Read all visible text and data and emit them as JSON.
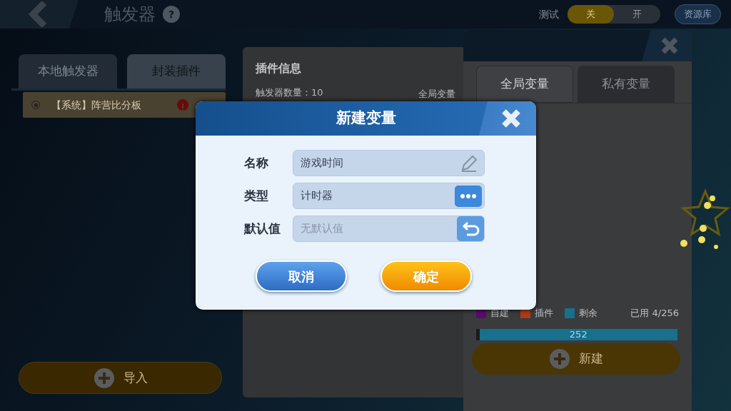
{
  "top_bar": {
    "title": "触发器",
    "help": "?",
    "test_label": "测试",
    "toggle": [
      {
        "label": "关",
        "selected": true
      },
      {
        "label": "开",
        "selected": false
      }
    ],
    "library_button": "资源库"
  },
  "left_panel": {
    "tabs": [
      {
        "label": "本地触发器",
        "selected": false
      },
      {
        "label": "封装插件",
        "selected": true
      }
    ],
    "items": [
      {
        "label": "【系统】阵营比分板",
        "selected": true,
        "warning": true
      }
    ],
    "import_button": "导入"
  },
  "info_panel": {
    "title": "插件信息",
    "trigger_count": "触发器数量：10",
    "global_vars": "全局变量"
  },
  "variables_panel": {
    "tabs": [
      {
        "label": "全局变量",
        "selected": true
      },
      {
        "label": "私有变量",
        "selected": false
      }
    ],
    "legend": [
      {
        "label": "自建",
        "color": "#5a0a6e"
      },
      {
        "label": "插件",
        "color": "#b03a16"
      },
      {
        "label": "剩余",
        "color": "#16708e"
      }
    ],
    "usage": "已用 4/256",
    "remaining": {
      "level": 0.984,
      "reading": "252"
    },
    "new_button": "新建"
  },
  "dialog": {
    "title": "新建变量",
    "fields": [
      {
        "label": "名称",
        "kind": "text",
        "value": "游戏时间"
      },
      {
        "label": "类型",
        "kind": "select",
        "value": "计时器"
      },
      {
        "label": "默认值",
        "kind": "reset",
        "placeholder": "无默认值"
      }
    ],
    "buttons": [
      {
        "label": "取消",
        "kind": "cancel"
      },
      {
        "label": "确定",
        "kind": "confirm"
      }
    ]
  }
}
